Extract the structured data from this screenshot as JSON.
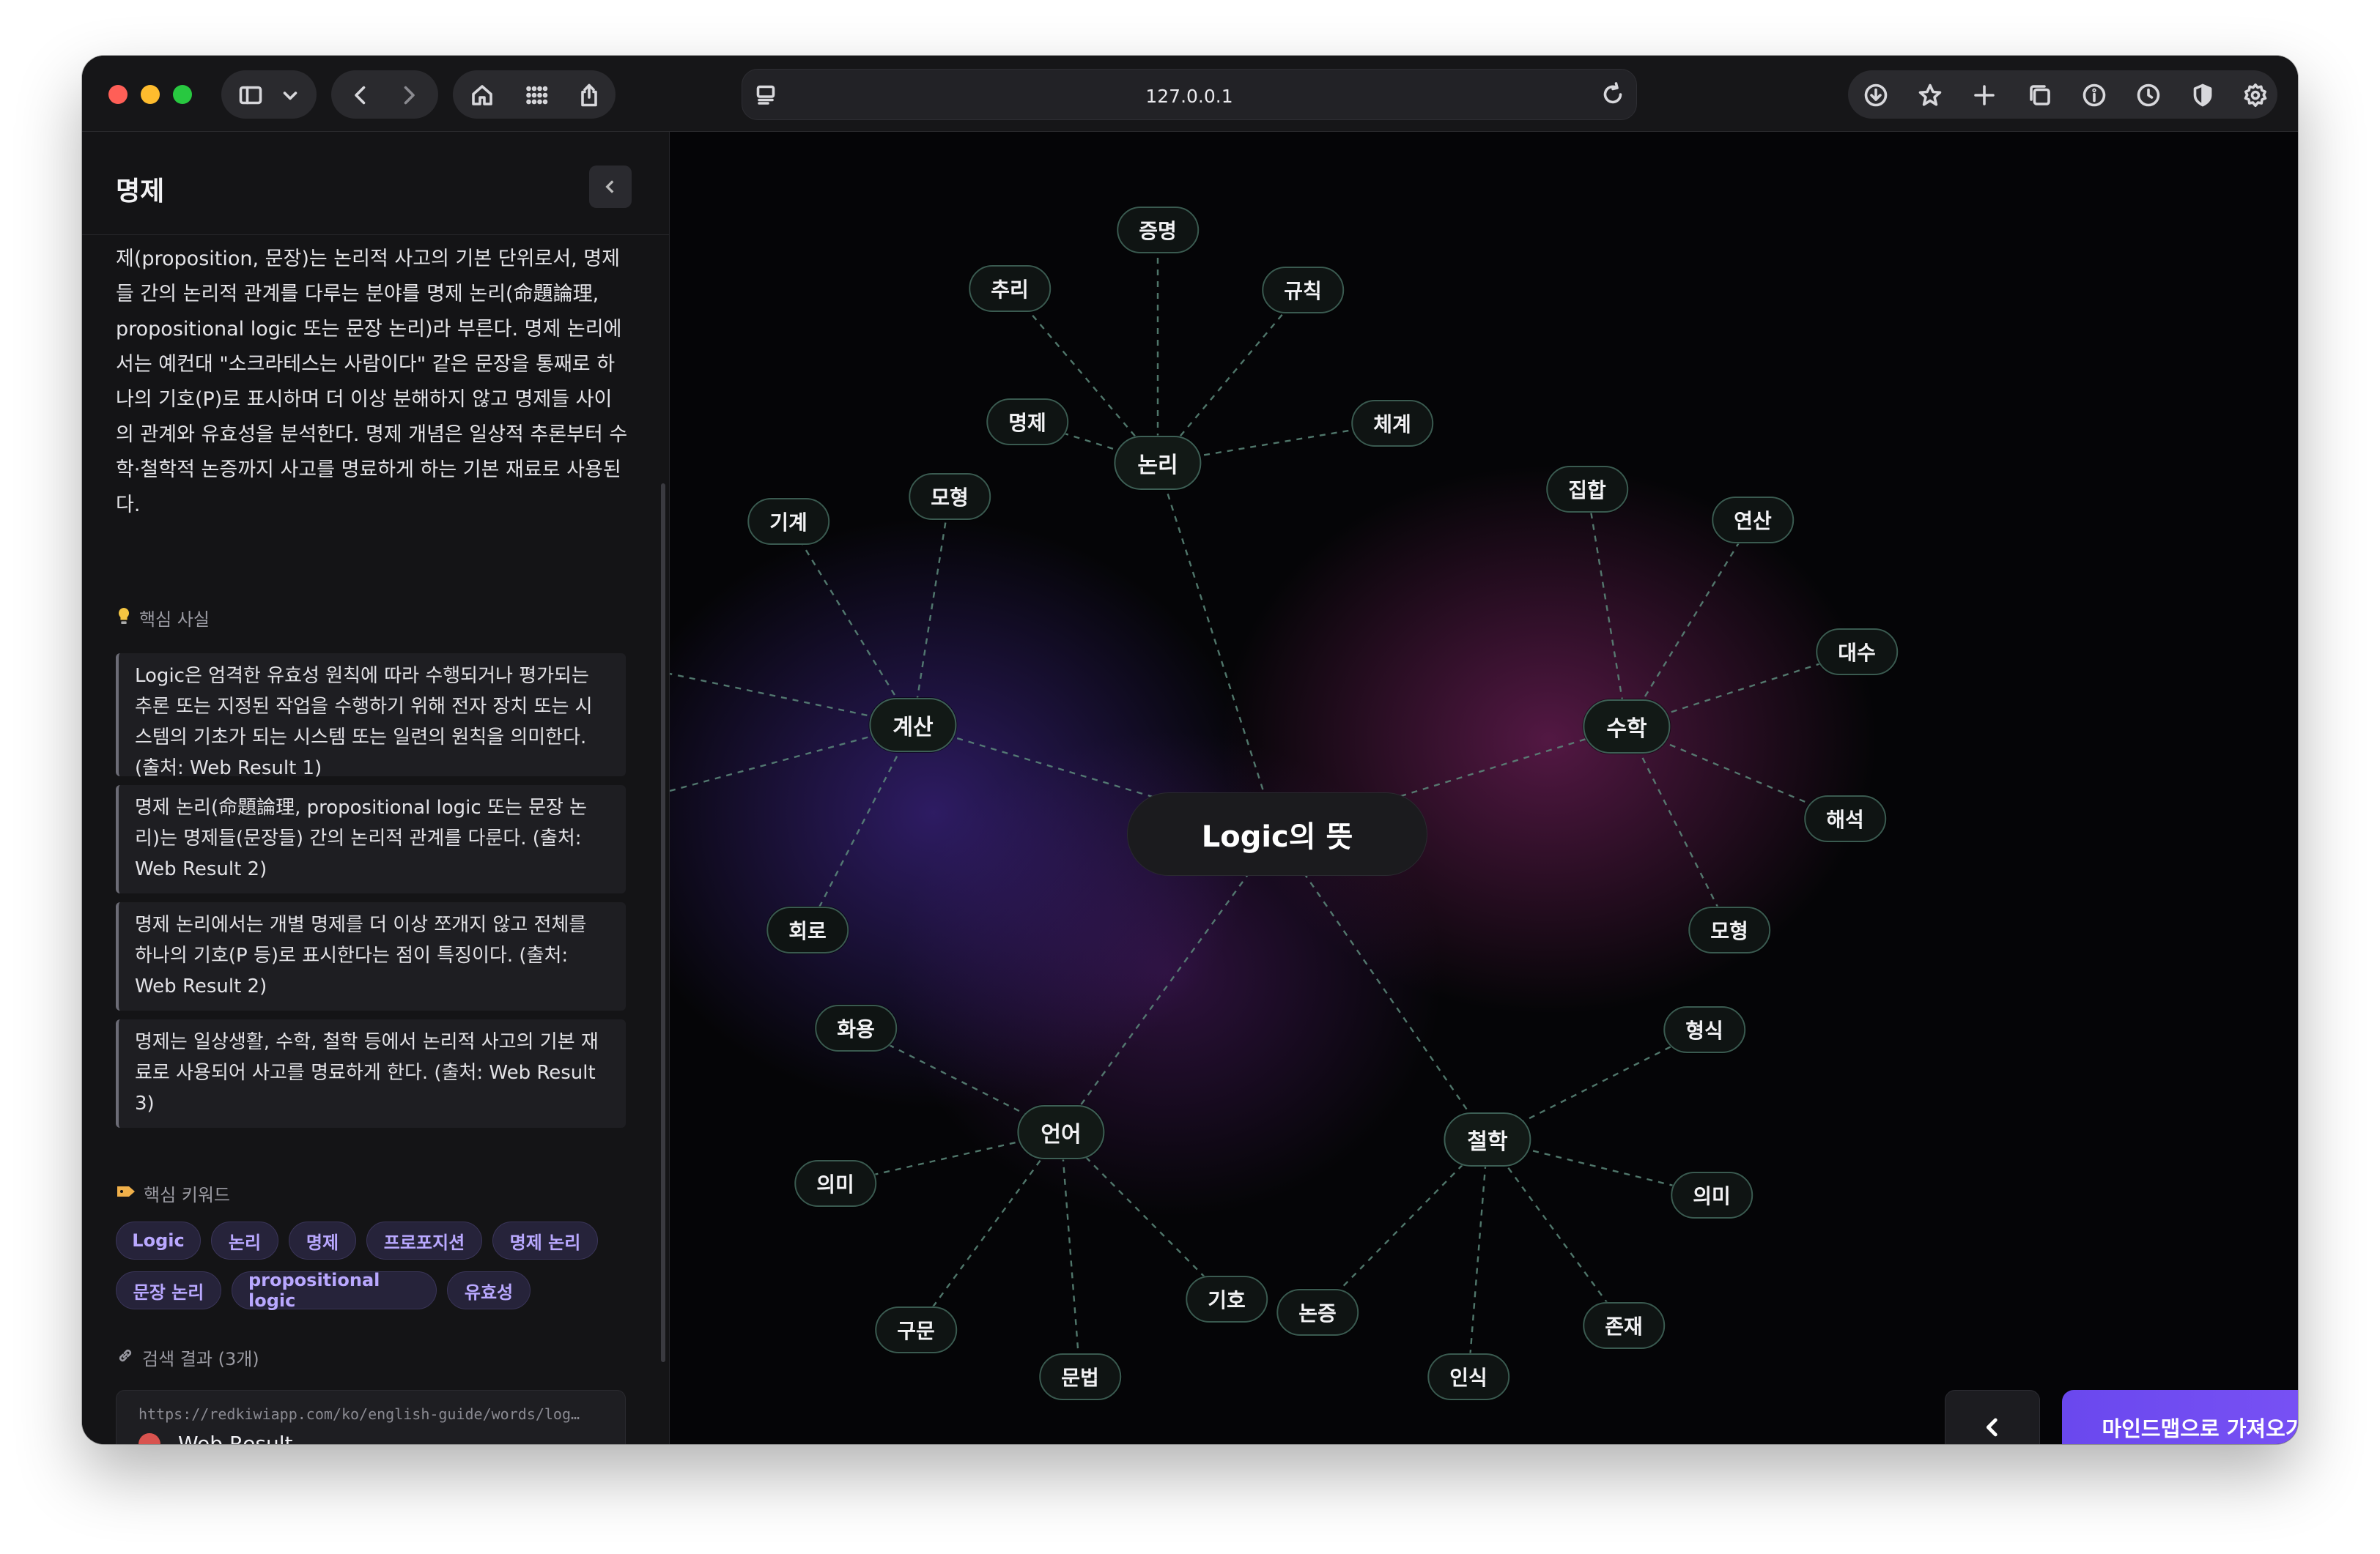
{
  "browser": {
    "url": "127.0.0.1"
  },
  "sidebar": {
    "title": "명제",
    "description": "제(proposition, 문장)는 논리적 사고의 기본 단위로서, 명제들 간의 논리적 관계를 다루는 분야를 명제 논리(命題論理, propositional logic 또는 문장 논리)라 부른다. 명제 논리에서는 예컨대 \"소크라테스는 사람이다\" 같은 문장을 통째로 하나의 기호(P)로 표시하며 더 이상 분해하지 않고 명제들 사이의 관계와 유효성을 분석한다. 명제 개념은 일상적 추론부터 수학·철학적 논증까지 사고를 명료하게 하는 기본 재료로 사용된다.",
    "facts_heading": "핵심 사실",
    "facts": [
      "Logic은 엄격한 유효성 원칙에 따라 수행되거나 평가되는 추론 또는 지정된 작업을 수행하기 위해 전자 장치 또는 시스템의 기초가 되는 시스템 또는 일련의 원칙을 의미한다. (출처: Web Result 1)",
      "명제 논리(命題論理, propositional logic 또는 문장 논리)는 명제들(문장들) 간의 논리적 관계를 다룬다. (출처: Web Result 2)",
      "명제 논리에서는 개별 명제를 더 이상 쪼개지 않고 전체를 하나의 기호(P 등)로 표시한다는 점이 특징이다. (출처: Web Result 2)",
      "명제는 일상생활, 수학, 철학 등에서 논리적 사고의 기본 재료로 사용되어 사고를 명료하게 한다. (출처: Web Result 3)"
    ],
    "keywords_heading": "핵심 키워드",
    "keywords": [
      "Logic",
      "논리",
      "명제",
      "프로포지션",
      "명제 논리",
      "문장 논리",
      "propositional logic",
      "유효성"
    ],
    "results_heading": "검색 결과 (3개)",
    "result": {
      "url": "https://redkiwiapp.com/ko/english-guide/words/log…",
      "title": "Web Result"
    }
  },
  "mindmap": {
    "center": "Logic의 뜻",
    "hubs": {
      "logic": "논리",
      "math": "수학",
      "compute": "계산",
      "language": "언어",
      "philosophy": "철학"
    },
    "leaves": {
      "proof": "증명",
      "reasoning": "추리",
      "rule": "규칙",
      "proposition": "명제",
      "system": "체계",
      "set": "집합",
      "operation": "연산",
      "algebra": "대수",
      "analysis": "해석",
      "model_math": "모형",
      "model_compute": "모형",
      "machine": "기계",
      "circuit": "회로",
      "pragmatics": "화용",
      "meaning_lang": "의미",
      "syntax": "구문",
      "grammar": "문법",
      "symbol": "기호",
      "argument": "논증",
      "cognition": "인식",
      "existence": "존재",
      "meaning_phil": "의미",
      "form": "형식"
    }
  },
  "actions": {
    "import_label": "마인드맵으로 가져오기"
  },
  "colors": {
    "accent": "#6a48ee",
    "keyword_text": "#b9a8ff",
    "edge": "#5d8a7c",
    "node_border": "#3a5a50"
  },
  "icons": [
    "sidebar-icon",
    "chevron-down-icon",
    "back-icon",
    "forward-icon",
    "home-icon",
    "grid-icon",
    "share-icon",
    "reader-icon",
    "reload-icon",
    "download-icon",
    "star-icon",
    "plus-icon",
    "tabs-icon",
    "info-icon",
    "history-icon",
    "shield-icon",
    "gear-icon",
    "lightbulb-icon",
    "tag-icon",
    "link-icon"
  ]
}
